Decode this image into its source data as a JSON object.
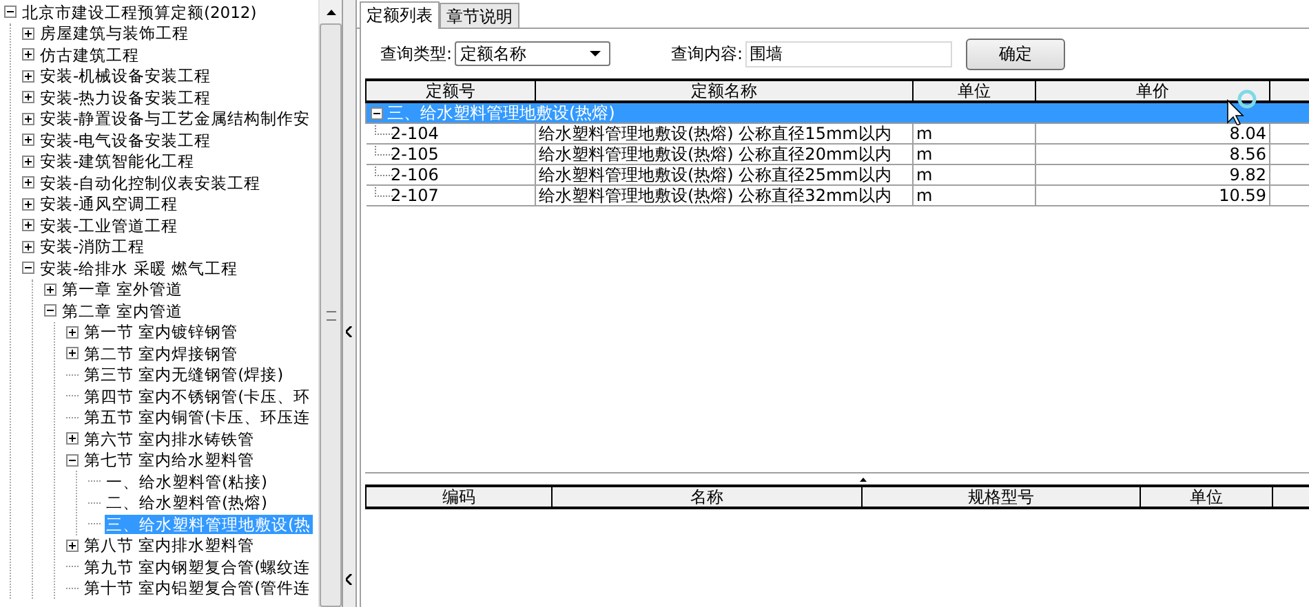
{
  "tree": {
    "label": "北京市建设工程预算定额(2012)",
    "expanded": true,
    "selected": false,
    "children": [
      {
        "label": "房屋建筑与装饰工程",
        "expanded": false,
        "selected": false
      },
      {
        "label": "仿古建筑工程",
        "expanded": false,
        "selected": false
      },
      {
        "label": "安装-机械设备安装工程",
        "expanded": false,
        "selected": false
      },
      {
        "label": "安装-热力设备安装工程",
        "expanded": false,
        "selected": false
      },
      {
        "label": "安装-静置设备与工艺金属结构制作安",
        "expanded": false,
        "selected": false
      },
      {
        "label": "安装-电气设备安装工程",
        "expanded": false,
        "selected": false
      },
      {
        "label": "安装-建筑智能化工程",
        "expanded": false,
        "selected": false
      },
      {
        "label": "安装-自动化控制仪表安装工程",
        "expanded": false,
        "selected": false
      },
      {
        "label": "安装-通风空调工程",
        "expanded": false,
        "selected": false
      },
      {
        "label": "安装-工业管道工程",
        "expanded": false,
        "selected": false
      },
      {
        "label": "安装-消防工程",
        "expanded": false,
        "selected": false
      },
      {
        "label": "安装-给排水 采暖 燃气工程",
        "expanded": true,
        "selected": false,
        "children": [
          {
            "label": "第一章 室外管道",
            "expanded": false,
            "selected": false
          },
          {
            "label": "第二章 室内管道",
            "expanded": true,
            "selected": false,
            "children": [
              {
                "label": "第一节 室内镀锌钢管",
                "expanded": false,
                "selected": false
              },
              {
                "label": "第二节 室内焊接钢管",
                "expanded": false,
                "selected": false
              },
              {
                "label": "第三节 室内无缝钢管(焊接)",
                "selected": false
              },
              {
                "label": "第四节 室内不锈钢管(卡压、环",
                "selected": false
              },
              {
                "label": "第五节 室内铜管(卡压、环压连",
                "selected": false
              },
              {
                "label": "第六节 室内排水铸铁管",
                "expanded": false,
                "selected": false
              },
              {
                "label": "第七节 室内给水塑料管",
                "expanded": true,
                "selected": false,
                "children": [
                  {
                    "label": "一、给水塑料管(粘接)",
                    "selected": false
                  },
                  {
                    "label": "二、给水塑料管(热熔)",
                    "selected": false
                  },
                  {
                    "label": "三、给水塑料管理地敷设(热",
                    "selected": true
                  }
                ]
              },
              {
                "label": "第八节 室内排水塑料管",
                "expanded": false,
                "selected": false
              },
              {
                "label": "第九节 室内钢塑复合管(螺纹连",
                "selected": false
              },
              {
                "label": "第十节 室内铝塑复合管(管件连",
                "selected": false
              }
            ]
          }
        ]
      }
    ]
  },
  "tabs": [
    {
      "label": "定额列表",
      "selected": true
    },
    {
      "label": "章节说明",
      "selected": false
    }
  ],
  "query": {
    "type_label": "查询类型:",
    "type_value": "定额名称",
    "content_label": "查询内容:",
    "content_value": "围墙",
    "button": "确定"
  },
  "quota_table": {
    "columns": [
      "定额号",
      "定额名称",
      "单位",
      "单价",
      ""
    ],
    "group": {
      "label": "三、给水塑料管理地敷设(热熔)",
      "expanded": true,
      "selected": true
    },
    "rows": [
      {
        "code": "2-104",
        "name": "给水塑料管理地敷设(热熔) 公称直径15mm以内",
        "unit": "m",
        "price": "8.04"
      },
      {
        "code": "2-105",
        "name": "给水塑料管理地敷设(热熔) 公称直径20mm以内",
        "unit": "m",
        "price": "8.56"
      },
      {
        "code": "2-106",
        "name": "给水塑料管理地敷设(热熔) 公称直径25mm以内",
        "unit": "m",
        "price": "9.82"
      },
      {
        "code": "2-107",
        "name": "给水塑料管理地敷设(热熔) 公称直径32mm以内",
        "unit": "m",
        "price": "10.59"
      }
    ]
  },
  "material_table": {
    "columns": [
      "编码",
      "名称",
      "规格型号",
      "单位",
      ""
    ]
  }
}
